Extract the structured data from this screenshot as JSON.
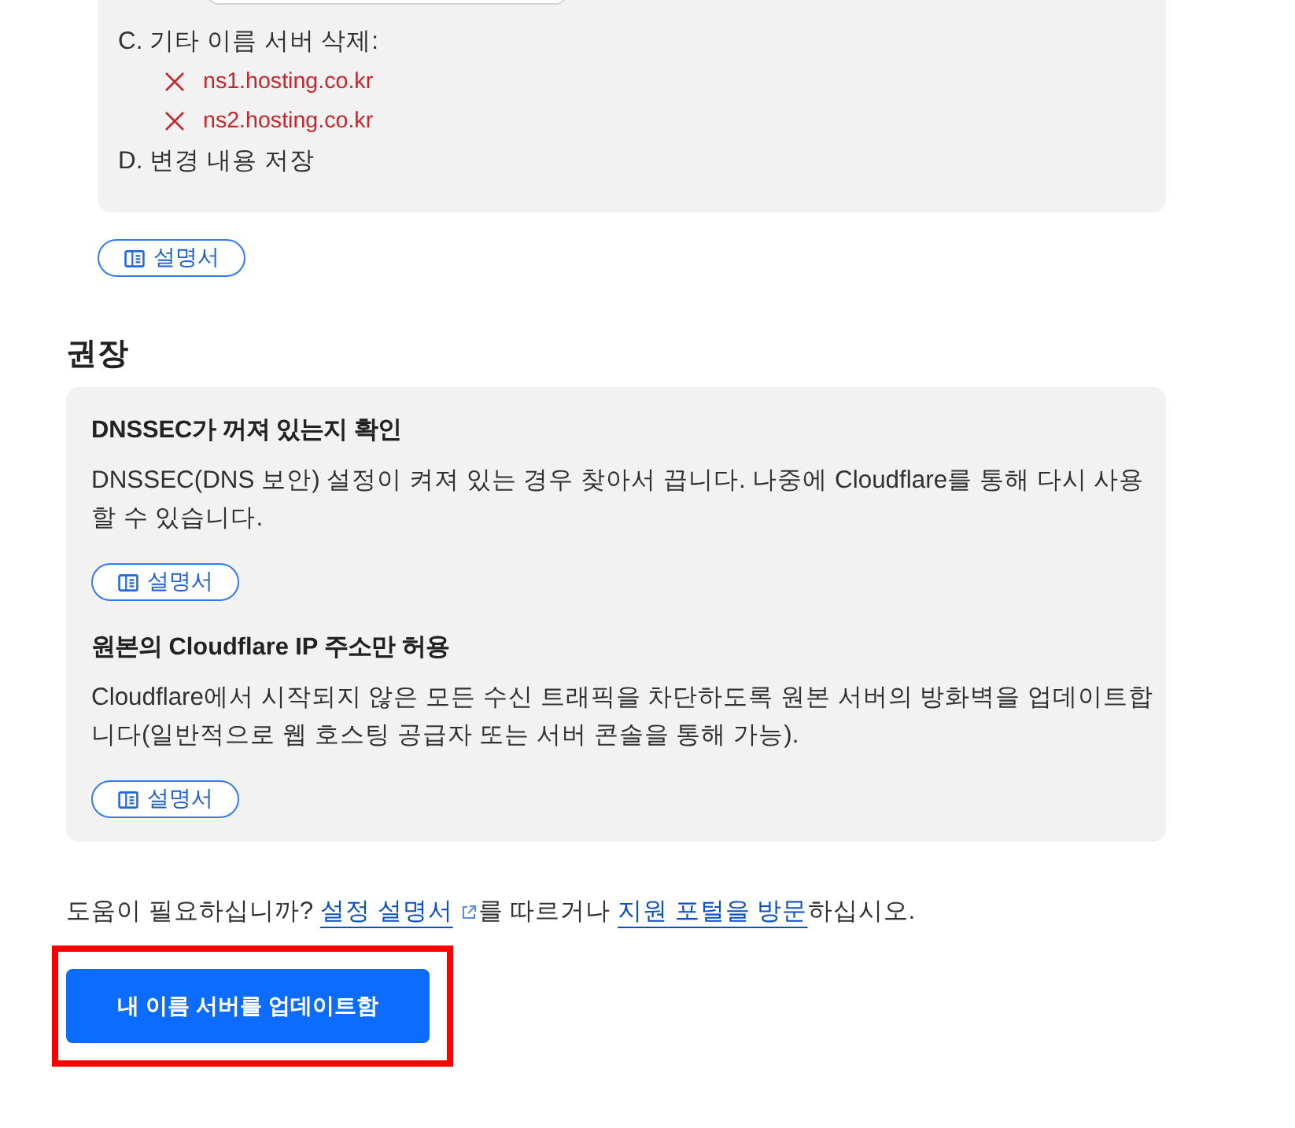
{
  "step_card": {
    "has_field": true,
    "steps": [
      {
        "label": "C. 기타 이름 서버 삭제:",
        "remove_items": [
          "ns1.hosting.co.kr",
          "ns2.hosting.co.kr"
        ]
      },
      {
        "label": "D. 변경 내용 저장"
      }
    ]
  },
  "manual_button": {
    "label": "설명서"
  },
  "recommended": {
    "title": "권장",
    "items": [
      {
        "title": "DNSSEC가 꺼져 있는지 확인",
        "description": "DNSSEC(DNS 보안) 설정이 켜져 있는 경우 찾아서 끕니다. 나중에 Cloudflare를 통해 다시 사용할 수 있습니다.",
        "button": "설명서"
      },
      {
        "title": "원본의 Cloudflare IP 주소만 허용",
        "description": "Cloudflare에서 시작되지 않은 모든 수신 트래픽을 차단하도록 원본 서버의 방화벽을 업데이트합니다(일반적으로 웹 호스팅 공급자 또는 서버 콘솔을 통해 가능).",
        "button": "설명서"
      }
    ]
  },
  "help_text": {
    "parts": [
      {
        "kind": "text",
        "text": "도움이 필요하십니까? "
      },
      {
        "kind": "link",
        "text": "설정 설명서",
        "external": true
      },
      {
        "kind": "text",
        "text": "를 따르거나 "
      },
      {
        "kind": "link",
        "text": "지원 포털을 방문",
        "external": false
      },
      {
        "kind": "text",
        "text": "하십시오."
      }
    ]
  },
  "primary_button": {
    "label": "내 이름 서버를 업데이트함",
    "highlighted": true
  }
}
